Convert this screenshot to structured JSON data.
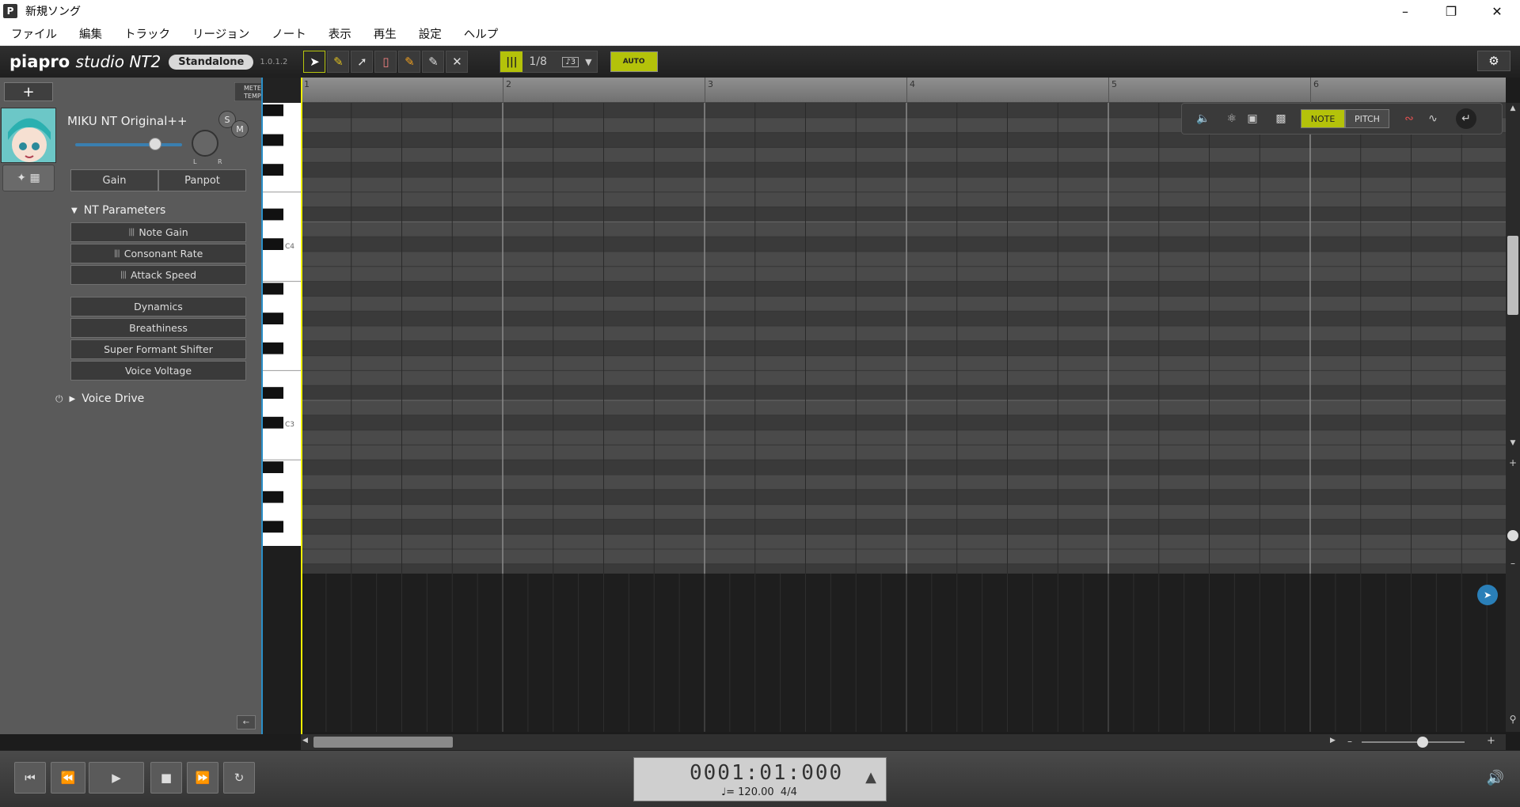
{
  "window": {
    "title": "新規ソング",
    "app_icon": "P"
  },
  "menu": [
    "ファイル",
    "編集",
    "トラック",
    "リージョン",
    "ノート",
    "表示",
    "再生",
    "設定",
    "ヘルプ"
  ],
  "toolbar": {
    "logo_main": "piapro",
    "logo_sub": "studio NT2",
    "edition": "Standalone",
    "version": "1.0.1.2",
    "grid": "1/8",
    "grid_sub": "♪3",
    "auto_label": "AUTO",
    "accent_color": "#b4c20a"
  },
  "track": {
    "add_label": "+",
    "meter_label": "METER",
    "tempo_label": "TEMPO",
    "name": "MIKU NT Original++",
    "solo": "S",
    "mute": "M",
    "knob_l": "L",
    "knob_r": "R",
    "volume_fraction": 0.74,
    "gain_label": "Gain",
    "panpot_label": "Panpot"
  },
  "nt_parameters": {
    "title": "NT Parameters",
    "items": [
      "Note Gain",
      "Consonant Rate",
      "Attack Speed"
    ]
  },
  "extra_parameters": [
    "Dynamics",
    "Breathiness",
    "Super Formant Shifter",
    "Voice Voltage"
  ],
  "voice_drive": {
    "title": "Voice Drive"
  },
  "keyboard": {
    "c4_label": "C4",
    "c3_label": "C3"
  },
  "ruler": {
    "bars": [
      "1",
      "2",
      "3",
      "4",
      "5",
      "6"
    ]
  },
  "floatbar": {
    "note_label": "NOTE",
    "pitch_label": "PITCH"
  },
  "transport": {
    "position": "0001:01:000",
    "tempo": "♩= 120.00",
    "meter": "4/4"
  },
  "colors": {
    "playhead": "#f0f000",
    "track_stripe": "#2a8fc8"
  }
}
